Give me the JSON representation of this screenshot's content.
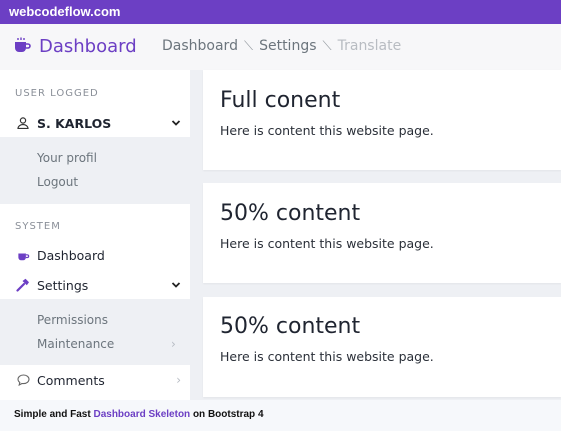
{
  "topbar": {
    "site": "webcodeflow.com"
  },
  "header": {
    "brand": "Dashboard",
    "breadcrumb": [
      "Dashboard",
      "Settings",
      "Translate"
    ]
  },
  "sidebar": {
    "user_section": "USER LOGGED",
    "user_name": "S. KARLOS",
    "user_menu": [
      "Your profil",
      "Logout"
    ],
    "system_section": "SYSTEM",
    "dashboard": "Dashboard",
    "settings": "Settings",
    "settings_menu": [
      "Permissions",
      "Maintenance"
    ],
    "comments": "Comments"
  },
  "cards": [
    {
      "title": "Full conent",
      "text": "Here is content this website page."
    },
    {
      "title": "50% content",
      "text": "Here is content this website page."
    },
    {
      "title": "50% content",
      "text": "Here is content this website page."
    }
  ],
  "footer": {
    "pre": "Simple and Fast ",
    "link": "Dashboard Skeleton",
    "post": " on Bootstrap 4"
  },
  "colors": {
    "accent": "#6c3fc4",
    "background": "#eef0f4"
  }
}
